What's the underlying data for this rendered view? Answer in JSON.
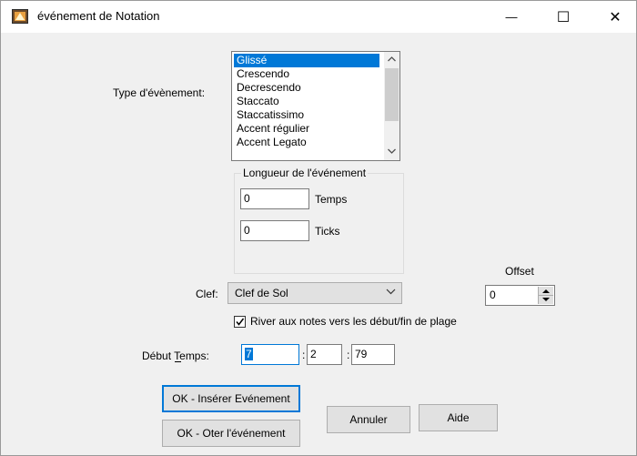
{
  "window": {
    "title": "événement de Notation",
    "minimize_glyph": "—",
    "maximize_glyph": "☐",
    "close_glyph": "✕"
  },
  "event_type": {
    "label": "Type d'évènement:",
    "items": [
      "Glissé",
      "Crescendo",
      "Decrescendo",
      "Staccato",
      "Staccatissimo",
      "Accent régulier",
      "Accent Legato"
    ],
    "selected_index": 0
  },
  "length_group": {
    "title": "Longueur de l'événement",
    "beats_value": "0",
    "beats_label": "Temps",
    "ticks_value": "0",
    "ticks_label": "Ticks"
  },
  "clef": {
    "label": "Clef:",
    "value": "Clef de Sol"
  },
  "offset": {
    "label": "Offset",
    "value": "0"
  },
  "snap": {
    "checked": true,
    "label": "River aux notes vers les début/fin de plage"
  },
  "start_time": {
    "label": "Début Temps:",
    "bar": "7",
    "sep1": ":",
    "beat": "2",
    "sep2": ":",
    "tick": "79"
  },
  "buttons": {
    "ok_insert": "OK - Insérer Evénement",
    "ok_remove": "OK - Oter l'événement",
    "cancel": "Annuler",
    "help": "Aide"
  }
}
